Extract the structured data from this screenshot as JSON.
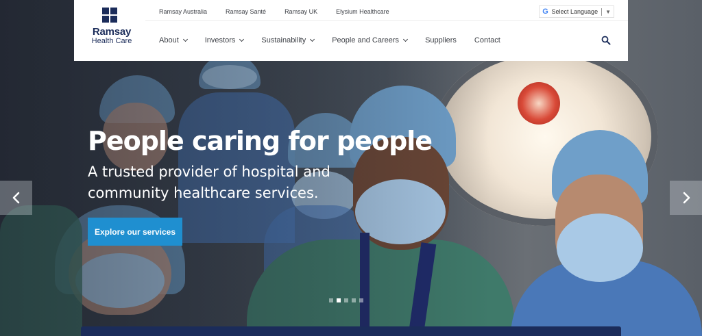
{
  "brand": {
    "name": "Ramsay",
    "subtitle": "Health Care",
    "color": "#1b2c5a"
  },
  "top_links": [
    "Ramsay Australia",
    "Ramsay Santé",
    "Ramsay UK",
    "Elysium Healthcare"
  ],
  "language": {
    "label": "Select Language",
    "icon": "google-icon"
  },
  "nav": [
    {
      "label": "About",
      "dropdown": true
    },
    {
      "label": "Investors",
      "dropdown": true
    },
    {
      "label": "Sustainability",
      "dropdown": true
    },
    {
      "label": "People and Careers",
      "dropdown": true
    },
    {
      "label": "Suppliers",
      "dropdown": false
    },
    {
      "label": "Contact",
      "dropdown": false
    }
  ],
  "hero": {
    "title": "People caring for people",
    "subtitle": "A trusted provider of hospital and community healthcare services.",
    "cta_label": "Explore our services",
    "cta_color": "#1f8fd0",
    "slide_count": 5,
    "active_slide": 2
  },
  "icons": {
    "search": "search-icon",
    "prev": "chevron-left-icon",
    "next": "chevron-right-icon"
  }
}
